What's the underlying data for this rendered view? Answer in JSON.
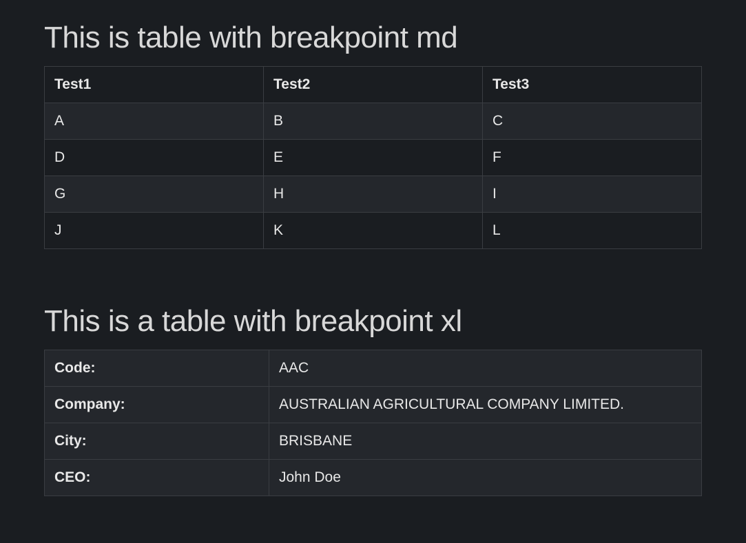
{
  "section1": {
    "title": "This is table with breakpoint md",
    "headers": [
      "Test1",
      "Test2",
      "Test3"
    ],
    "rows": [
      [
        "A",
        "B",
        "C"
      ],
      [
        "D",
        "E",
        "F"
      ],
      [
        "G",
        "H",
        "I"
      ],
      [
        "J",
        "K",
        "L"
      ]
    ]
  },
  "section2": {
    "title": "This is a table with breakpoint xl",
    "rows": [
      {
        "label": "Code:",
        "value": "AAC"
      },
      {
        "label": "Company:",
        "value": "AUSTRALIAN AGRICULTURAL COMPANY LIMITED."
      },
      {
        "label": "City:",
        "value": "BRISBANE"
      },
      {
        "label": "CEO:",
        "value": "John Doe"
      }
    ]
  }
}
